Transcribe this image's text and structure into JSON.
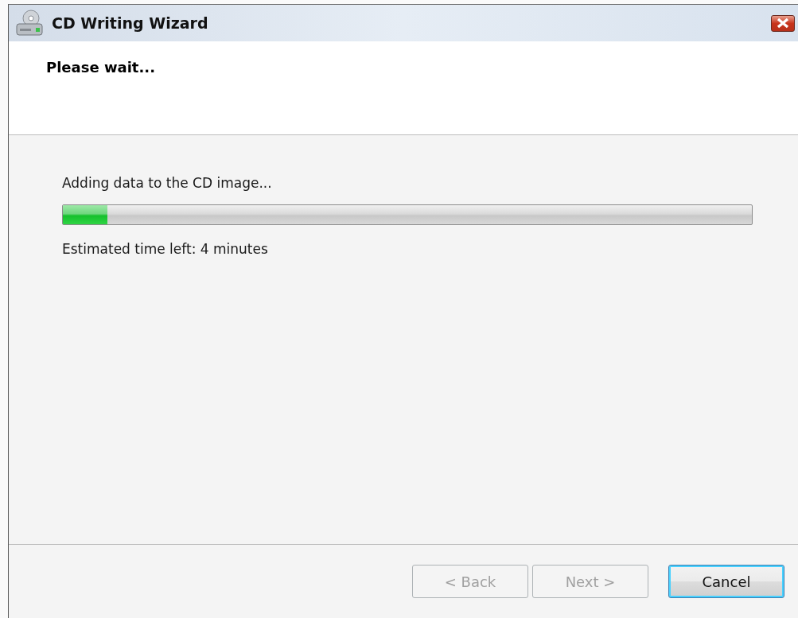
{
  "window": {
    "title": "CD Writing Wizard"
  },
  "header": {
    "title": "Please wait..."
  },
  "progress": {
    "label": "Adding data to the CD image...",
    "level": 0.065,
    "status": "Estimated time left: 4 minutes"
  },
  "buttons": [
    {
      "label": "< Back",
      "disabled": true,
      "default": false
    },
    {
      "label": "Next >",
      "disabled": true,
      "default": false
    },
    {
      "label": "Cancel",
      "disabled": false,
      "default": true
    }
  ]
}
